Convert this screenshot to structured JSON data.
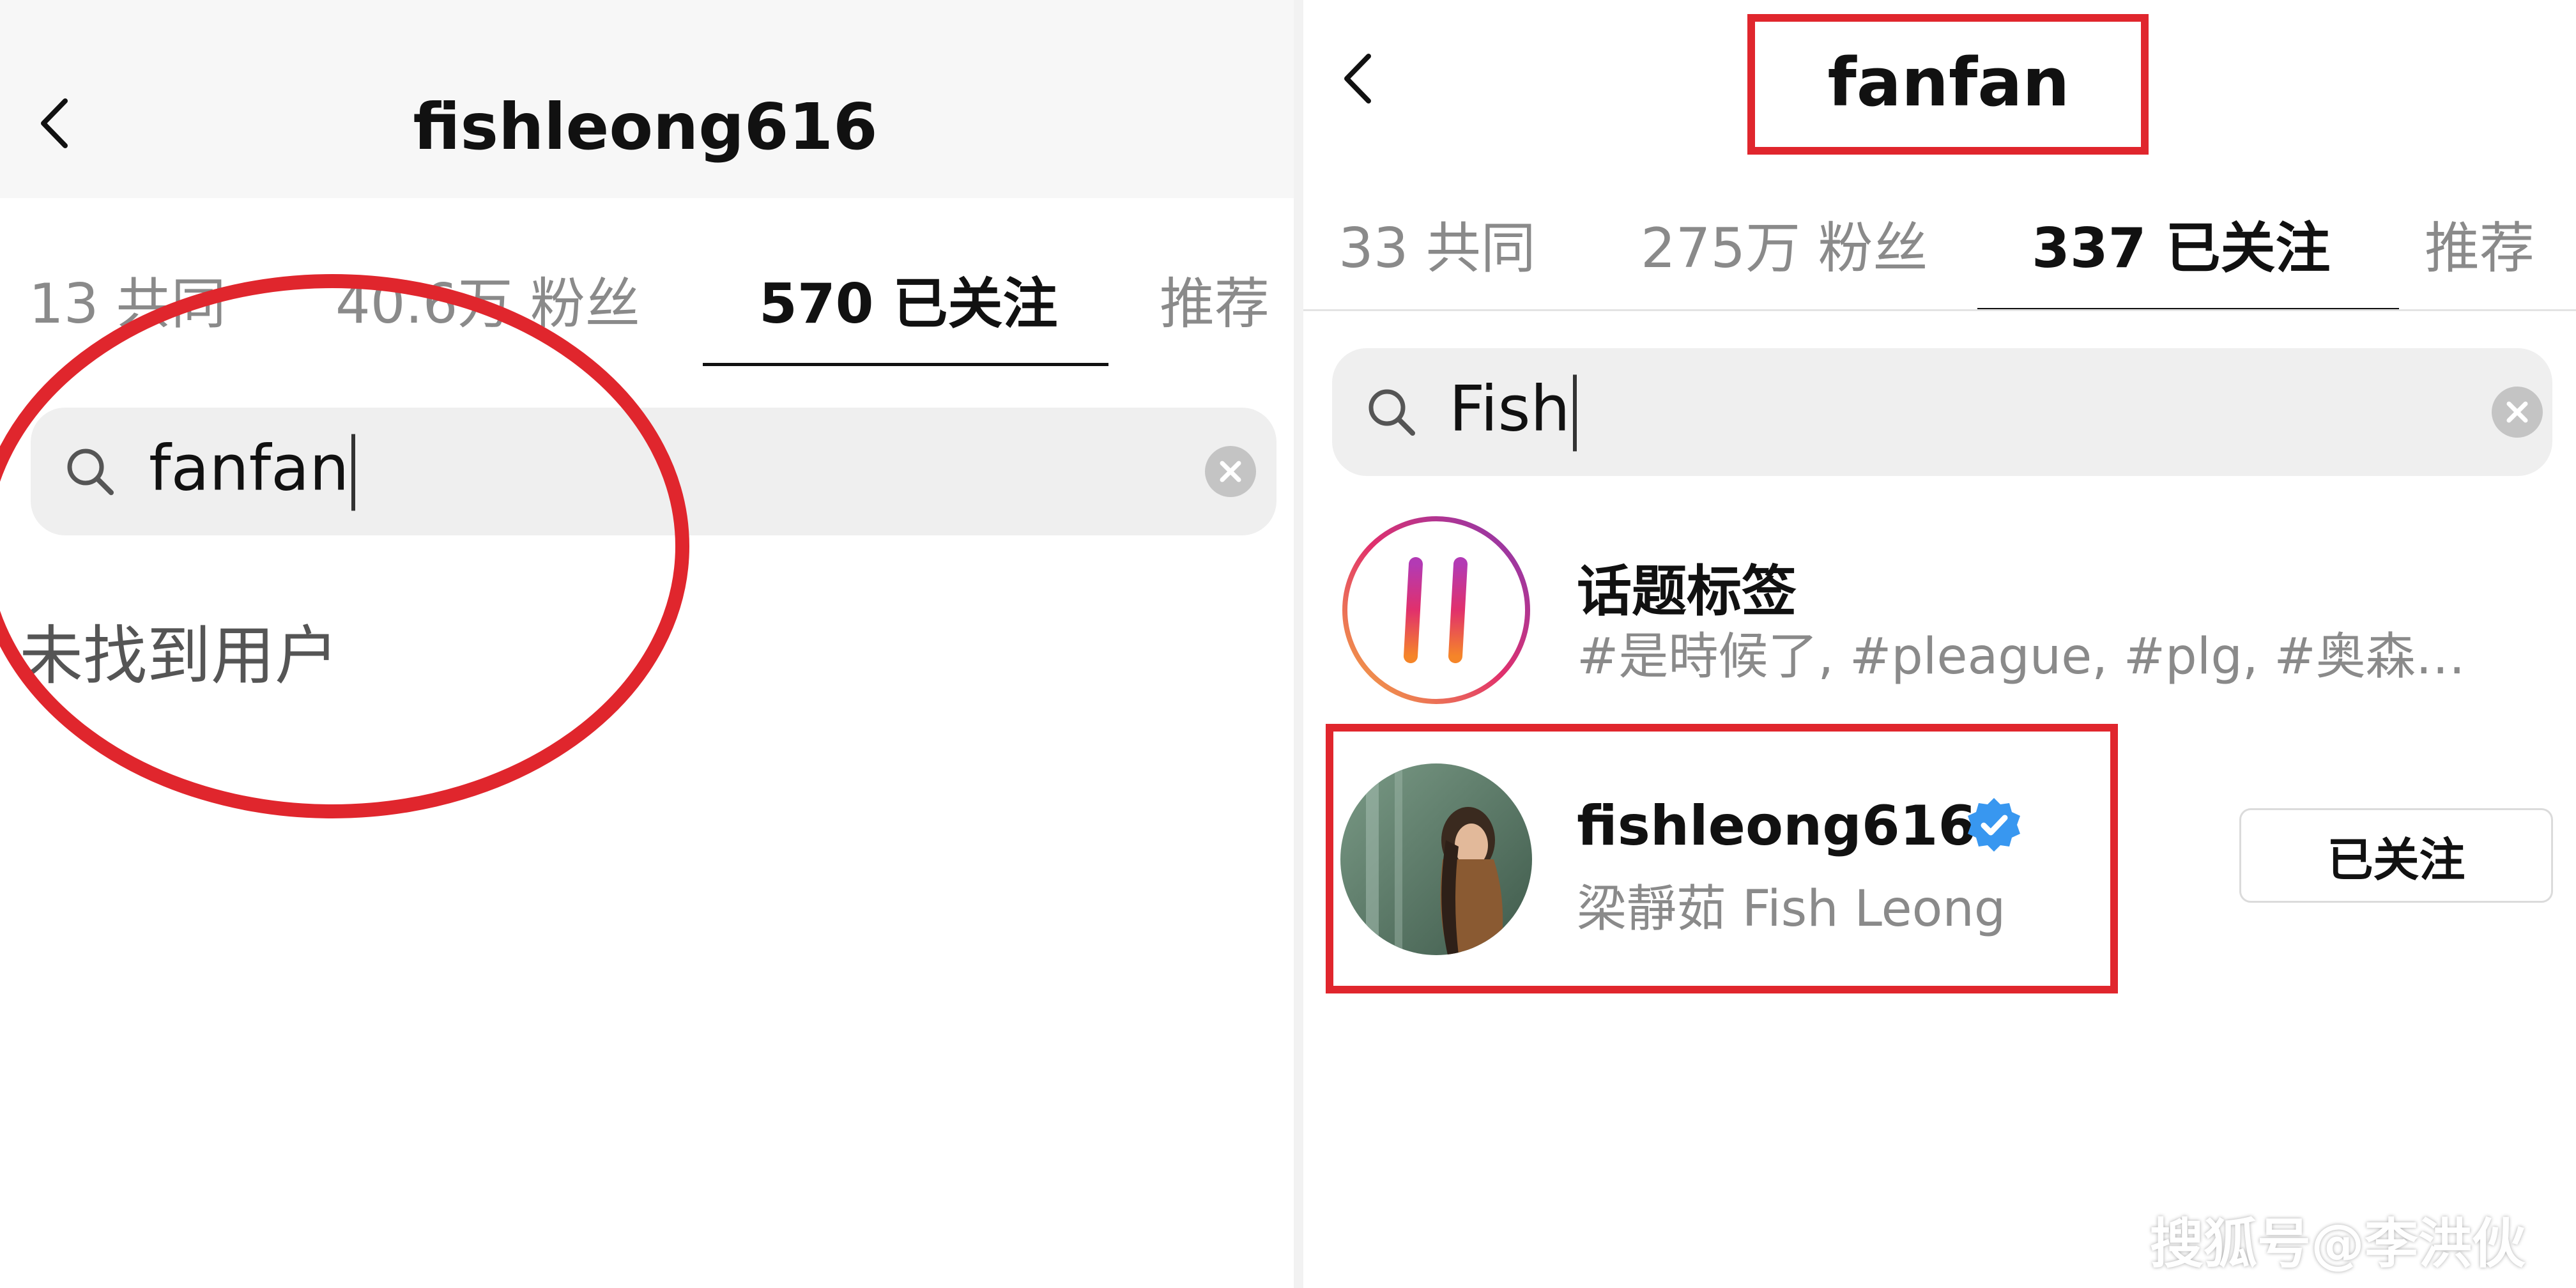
{
  "left_screen": {
    "header": {
      "title": "fishleong616"
    },
    "tabs": [
      {
        "label": "13 共同"
      },
      {
        "label": "40.6万 粉丝"
      },
      {
        "label": "570 已关注"
      },
      {
        "label": "推荐"
      }
    ],
    "search": {
      "value": "fanfan"
    },
    "empty_state": {
      "text": "未找到用户"
    }
  },
  "right_screen": {
    "header": {
      "title": "fanfan"
    },
    "tabs": [
      {
        "label": "33 共同"
      },
      {
        "label": "275万 粉丝"
      },
      {
        "label": "337 已关注"
      },
      {
        "label": "推荐"
      }
    ],
    "search": {
      "value": "Fish"
    },
    "hashtag_result": {
      "title": "话题标签",
      "subtitle": "#是時候了, #pleague, #plg, #奥森…"
    },
    "user_result": {
      "username": "fishleong616",
      "display_name": "梁靜茹 Fish Leong",
      "verified": true,
      "button_label": "已关注"
    }
  },
  "watermark": {
    "text": "搜狐号@李洪伙"
  },
  "colors": {
    "annotation_red": "#e0262d",
    "verified_blue": "#3897f0",
    "muted_text": "#8a8a8a"
  },
  "icons": {
    "back": "chevron-left-icon",
    "search": "search-icon",
    "clear": "clear-circle-icon",
    "hashtag": "hashtag-icon",
    "verified": "verified-badge-icon"
  }
}
